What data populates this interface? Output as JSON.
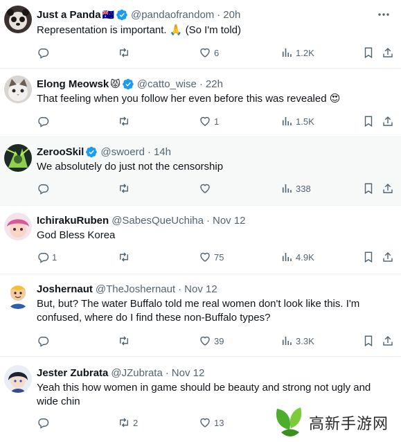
{
  "colors": {
    "verified": "#1d9bf0",
    "text": "#0f1419",
    "secondary": "#536471",
    "divider": "#eff3f4",
    "watermark_green": "#4caf2b"
  },
  "tweets": [
    {
      "name": "Just a Panda",
      "emoji": "🇦🇺",
      "verified": true,
      "handle": "@pandaofrandom",
      "time": "20h",
      "text": "Representation is important. 🙏 (So I'm told)",
      "replies": "",
      "reposts": "",
      "likes": "6",
      "views": "1.2K"
    },
    {
      "name": "Elong Meowsk",
      "emoji": "😾",
      "verified": true,
      "handle": "@catto_wise",
      "time": "22h",
      "text": "That  feeling when you follow her even before this was revealed 😍",
      "replies": "",
      "reposts": "",
      "likes": "1",
      "views": "1.5K"
    },
    {
      "name": "ZerooSkil",
      "emoji": "",
      "verified": true,
      "handle": "@swoerd",
      "time": "14h",
      "text": "We absolutely do just not the censorship",
      "replies": "",
      "reposts": "",
      "likes": "",
      "views": "338"
    },
    {
      "name": "IchirakuRuben",
      "emoji": "",
      "verified": false,
      "handle": "@SabesQueUchiha",
      "time": "Nov 12",
      "text": "God Bless Korea",
      "replies": "1",
      "reposts": "",
      "likes": "75",
      "views": "4.9K"
    },
    {
      "name": "Joshernaut",
      "emoji": "",
      "verified": false,
      "handle": "@TheJoshernaut",
      "time": "Nov 12",
      "text": "But, but? The water Buffalo told me real women don't look like this. I'm confused, where do I find these non-Buffalo types?",
      "replies": "",
      "reposts": "",
      "likes": "39",
      "views": "3.3K"
    },
    {
      "name": "Jester Zubrata",
      "emoji": "",
      "verified": false,
      "handle": "@JZubrata",
      "time": "Nov 12",
      "text": "Yeah this how women in game  should be beauty and strong not ugly and wide chin",
      "replies": "",
      "reposts": "2",
      "likes": "13",
      "views": ""
    }
  ],
  "watermark": {
    "text": "高新手游网"
  }
}
